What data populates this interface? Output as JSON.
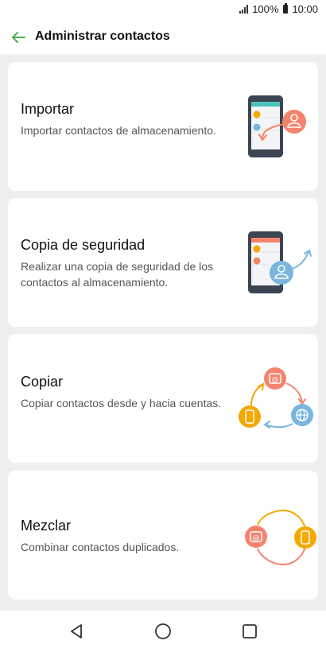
{
  "status_bar": {
    "battery": "100%",
    "time": "10:00"
  },
  "header": {
    "title": "Administrar contactos"
  },
  "cards": [
    {
      "title": "Importar",
      "description": "Importar contactos de almacenamiento.",
      "icon": "import-illustration"
    },
    {
      "title": "Copia de seguridad",
      "description": "Realizar una copia de seguridad de los contactos al almacenamiento.",
      "icon": "backup-illustration"
    },
    {
      "title": "Copiar",
      "description": "Copiar contactos desde y hacia cuentas.",
      "icon": "copy-illustration"
    },
    {
      "title": "Mezclar",
      "description": "Combinar contactos duplicados.",
      "icon": "merge-illustration"
    }
  ],
  "colors": {
    "accent_green": "#4caf50",
    "coral": "#f4846c",
    "orange": "#f5a800",
    "blue": "#7ab6db",
    "phone_dark": "#3b4451"
  }
}
